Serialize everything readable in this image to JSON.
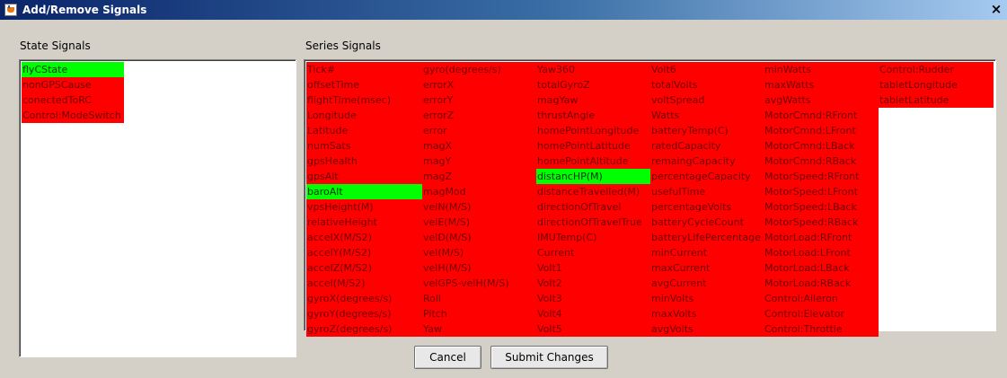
{
  "window": {
    "title": "Add/Remove Signals",
    "close_glyph": "×",
    "icon": "java-cup-icon"
  },
  "state": {
    "label": "State Signals",
    "items": [
      {
        "label": "flyCState",
        "status": "green"
      },
      {
        "label": "nonGPSCause",
        "status": "red"
      },
      {
        "label": "conectedToRC",
        "status": "red"
      },
      {
        "label": "Control:ModeSwitch",
        "status": "red"
      }
    ]
  },
  "series": {
    "label": "Series Signals",
    "columns": [
      [
        {
          "label": "Tick#",
          "status": "red"
        },
        {
          "label": "offsetTime",
          "status": "red"
        },
        {
          "label": "flightTime(msec)",
          "status": "red"
        },
        {
          "label": "Longitude",
          "status": "red"
        },
        {
          "label": "Latitude",
          "status": "red"
        },
        {
          "label": "numSats",
          "status": "red"
        },
        {
          "label": "gpsHealth",
          "status": "red"
        },
        {
          "label": "gpsAlt",
          "status": "red"
        },
        {
          "label": "baroAlt",
          "status": "green"
        },
        {
          "label": "vpsHeight(M)",
          "status": "red"
        },
        {
          "label": "relativeHeight",
          "status": "red"
        },
        {
          "label": "accelX(M/S2)",
          "status": "red"
        },
        {
          "label": "accelY(M/S2)",
          "status": "red"
        },
        {
          "label": "accelZ(M/S2)",
          "status": "red"
        },
        {
          "label": "accel(M/S2)",
          "status": "red"
        },
        {
          "label": "gyroX(degrees/s)",
          "status": "red"
        },
        {
          "label": "gyroY(degrees/s)",
          "status": "red"
        },
        {
          "label": "gyroZ(degrees/s)",
          "status": "red"
        }
      ],
      [
        {
          "label": "gyro(degrees/s)",
          "status": "red"
        },
        {
          "label": "errorX",
          "status": "red"
        },
        {
          "label": "errorY",
          "status": "red"
        },
        {
          "label": "errorZ",
          "status": "red"
        },
        {
          "label": "error",
          "status": "red"
        },
        {
          "label": "magX",
          "status": "red"
        },
        {
          "label": "magY",
          "status": "red"
        },
        {
          "label": "magZ",
          "status": "red"
        },
        {
          "label": "magMod",
          "status": "red"
        },
        {
          "label": "velN(M/S)",
          "status": "red"
        },
        {
          "label": "velE(M/S)",
          "status": "red"
        },
        {
          "label": "velD(M/S)",
          "status": "red"
        },
        {
          "label": "vel(M/S)",
          "status": "red"
        },
        {
          "label": "velH(M/S)",
          "status": "red"
        },
        {
          "label": "velGPS-velH(M/S)",
          "status": "red"
        },
        {
          "label": "Roll",
          "status": "red"
        },
        {
          "label": "Pitch",
          "status": "red"
        },
        {
          "label": "Yaw",
          "status": "red"
        }
      ],
      [
        {
          "label": "Yaw360",
          "status": "red"
        },
        {
          "label": "totalGyroZ",
          "status": "red"
        },
        {
          "label": "magYaw",
          "status": "red"
        },
        {
          "label": "thrustAngle",
          "status": "red"
        },
        {
          "label": "homePointLongitude",
          "status": "red"
        },
        {
          "label": "homePointLatitude",
          "status": "red"
        },
        {
          "label": "homePointAltitude",
          "status": "red"
        },
        {
          "label": "distancHP(M)",
          "status": "green"
        },
        {
          "label": "distanceTravelled(M)",
          "status": "red"
        },
        {
          "label": "directionOfTravel",
          "status": "red"
        },
        {
          "label": "directionOfTravelTrue",
          "status": "red"
        },
        {
          "label": "IMUTemp(C)",
          "status": "red"
        },
        {
          "label": "Current",
          "status": "red"
        },
        {
          "label": "Volt1",
          "status": "red"
        },
        {
          "label": "Volt2",
          "status": "red"
        },
        {
          "label": "Volt3",
          "status": "red"
        },
        {
          "label": "Volt4",
          "status": "red"
        },
        {
          "label": "Volt5",
          "status": "red"
        }
      ],
      [
        {
          "label": "Volt6",
          "status": "red"
        },
        {
          "label": "totalVolts",
          "status": "red"
        },
        {
          "label": "voltSpread",
          "status": "red"
        },
        {
          "label": "Watts",
          "status": "red"
        },
        {
          "label": "batteryTemp(C)",
          "status": "red"
        },
        {
          "label": "ratedCapacity",
          "status": "red"
        },
        {
          "label": "remaingCapacity",
          "status": "red"
        },
        {
          "label": "percentageCapacity",
          "status": "red"
        },
        {
          "label": "usefulTime",
          "status": "red"
        },
        {
          "label": "percentageVolts",
          "status": "red"
        },
        {
          "label": "batteryCycleCount",
          "status": "red"
        },
        {
          "label": "batteryLifePercentage",
          "status": "red"
        },
        {
          "label": "minCurrent",
          "status": "red"
        },
        {
          "label": "maxCurrent",
          "status": "red"
        },
        {
          "label": "avgCurrent",
          "status": "red"
        },
        {
          "label": "minVolts",
          "status": "red"
        },
        {
          "label": "maxVolts",
          "status": "red"
        },
        {
          "label": "avgVolts",
          "status": "red"
        }
      ],
      [
        {
          "label": "minWatts",
          "status": "red"
        },
        {
          "label": "maxWatts",
          "status": "red"
        },
        {
          "label": "avgWatts",
          "status": "red"
        },
        {
          "label": "MotorCmnd:RFront",
          "status": "red"
        },
        {
          "label": "MotorCmnd:LFront",
          "status": "red"
        },
        {
          "label": "MotorCmnd:LBack",
          "status": "red"
        },
        {
          "label": "MotorCmnd:RBack",
          "status": "red"
        },
        {
          "label": "MotorSpeed:RFront",
          "status": "red"
        },
        {
          "label": "MotorSpeed:LFront",
          "status": "red"
        },
        {
          "label": "MotorSpeed:LBack",
          "status": "red"
        },
        {
          "label": "MotorSpeed:RBack",
          "status": "red"
        },
        {
          "label": "MotorLoad:RFront",
          "status": "red"
        },
        {
          "label": "MotorLoad:LFront",
          "status": "red"
        },
        {
          "label": "MotorLoad:LBack",
          "status": "red"
        },
        {
          "label": "MotorLoad:RBack",
          "status": "red"
        },
        {
          "label": "Control:Aileron",
          "status": "red"
        },
        {
          "label": "Control:Elevator",
          "status": "red"
        },
        {
          "label": "Control:Throttle",
          "status": "red"
        }
      ],
      [
        {
          "label": "Control:Rudder",
          "status": "red"
        },
        {
          "label": "tabletLongitude",
          "status": "red"
        },
        {
          "label": "tabletLatitude",
          "status": "red"
        }
      ]
    ]
  },
  "buttons": {
    "cancel": "Cancel",
    "submit": "Submit Changes"
  },
  "colors": {
    "selected": "#00ff00",
    "unselected": "#ff0000",
    "dialog_bg": "#d4d0c8"
  }
}
